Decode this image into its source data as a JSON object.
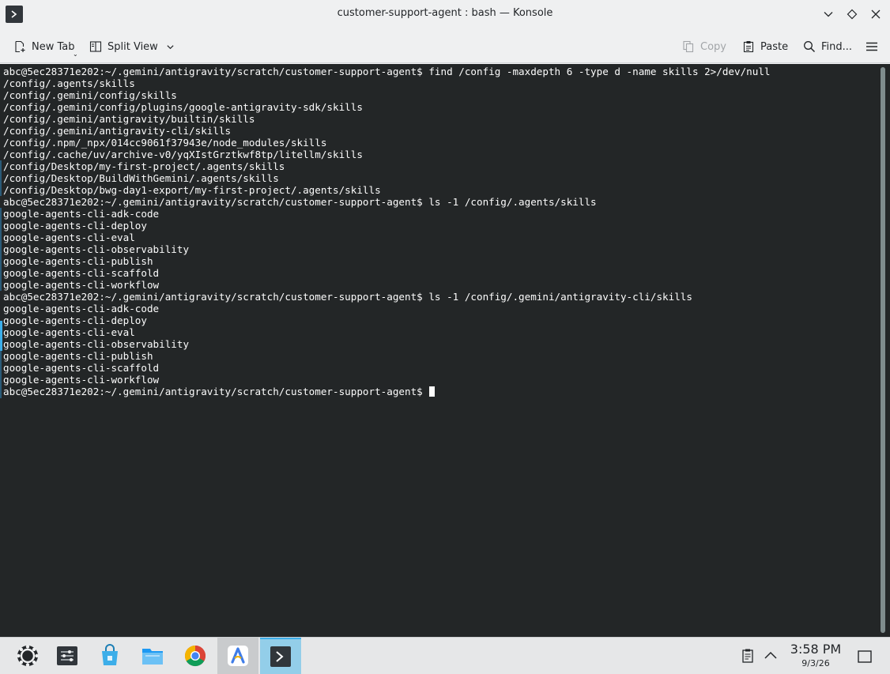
{
  "window": {
    "title": "customer-support-agent : bash — Konsole"
  },
  "toolbar": {
    "new_tab_label": "New Tab",
    "split_view_label": "Split View",
    "copy_label": "Copy",
    "paste_label": "Paste",
    "find_label": "Find..."
  },
  "terminal": {
    "lines": [
      "abc@5ec28371e202:~/.gemini/antigravity/scratch/customer-support-agent$ find /config -maxdepth 6 -type d -name skills 2>/dev/null",
      "/config/.agents/skills",
      "/config/.gemini/config/skills",
      "/config/.gemini/config/plugins/google-antigravity-sdk/skills",
      "/config/.gemini/antigravity/builtin/skills",
      "/config/.gemini/antigravity-cli/skills",
      "/config/.npm/_npx/014cc9061f37943e/node_modules/skills",
      "/config/.cache/uv/archive-v0/yqXIstGrztkwf8tp/litellm/skills",
      "/config/Desktop/my-first-project/.agents/skills",
      "/config/Desktop/BuildWithGemini/.agents/skills",
      "/config/Desktop/bwg-day1-export/my-first-project/.agents/skills",
      "abc@5ec28371e202:~/.gemini/antigravity/scratch/customer-support-agent$ ls -1 /config/.agents/skills",
      "google-agents-cli-adk-code",
      "google-agents-cli-deploy",
      "google-agents-cli-eval",
      "google-agents-cli-observability",
      "google-agents-cli-publish",
      "google-agents-cli-scaffold",
      "google-agents-cli-workflow",
      "abc@5ec28371e202:~/.gemini/antigravity/scratch/customer-support-agent$ ls -1 /config/.gemini/antigravity-cli/skills",
      "google-agents-cli-adk-code",
      "google-agents-cli-deploy",
      "google-agents-cli-eval",
      "google-agents-cli-observability",
      "google-agents-cli-publish",
      "google-agents-cli-scaffold",
      "google-agents-cli-workflow"
    ],
    "prompt": "abc@5ec28371e202:~/.gemini/antigravity/scratch/customer-support-agent$ "
  },
  "taskbar": {
    "items": [
      "app-launcher-icon",
      "system-settings-icon",
      "discover-store-icon",
      "file-manager-icon",
      "chrome-browser-icon",
      "antigravity-icon",
      "konsole-icon"
    ],
    "clock_time": "3:58 PM",
    "clock_date": "9/3/26"
  },
  "colors": {
    "terminal_bg": "#232627",
    "terminal_fg": "#fcfcfc",
    "accent": "#3daee9"
  }
}
